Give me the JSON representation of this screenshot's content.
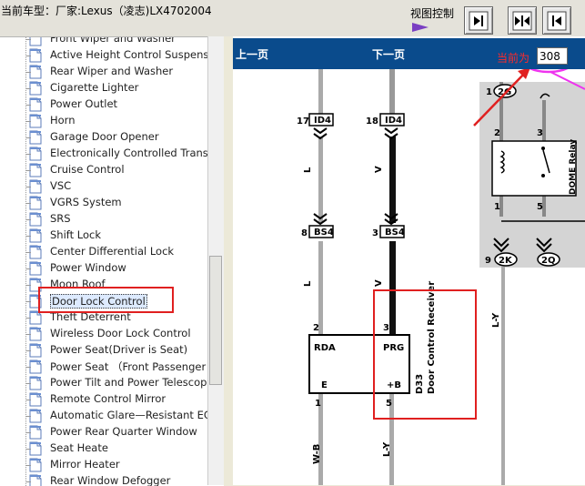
{
  "header": {
    "vehicle_label": "当前车型：厂家:Lexus（凌志)LX4702004",
    "view_control_label": "视图控制",
    "buttons": [
      {
        "name": "collapse-left-panel-button",
        "icon": "collapse-left-icon"
      },
      {
        "name": "show-both-panels-button",
        "icon": "expand-both-icon"
      },
      {
        "name": "collapse-right-panel-button",
        "icon": "collapse-right-icon"
      }
    ]
  },
  "tree": {
    "items": [
      {
        "label": "Front Wiper and Washer"
      },
      {
        "label": "Active Height Control Suspens"
      },
      {
        "label": "Rear Wiper and Washer"
      },
      {
        "label": "Cigarette Lighter"
      },
      {
        "label": "Power Outlet"
      },
      {
        "label": "Horn"
      },
      {
        "label": "Garage Door Opener"
      },
      {
        "label": "Electronically Controlled Trans"
      },
      {
        "label": "Cruise Control"
      },
      {
        "label": "VSC"
      },
      {
        "label": "VGRS System"
      },
      {
        "label": "SRS"
      },
      {
        "label": "Shift Lock"
      },
      {
        "label": "Center Differential Lock"
      },
      {
        "label": "Power Window"
      },
      {
        "label": "Moon Roof"
      },
      {
        "label": "Door Lock Control",
        "selected": true
      },
      {
        "label": "Theft Deterrent"
      },
      {
        "label": "Wireless Door Lock Control"
      },
      {
        "label": "Power Seat(Driver is Seat)"
      },
      {
        "label": "Power Seat （Front Passenger"
      },
      {
        "label": "Power Tilt and Power Telescop"
      },
      {
        "label": "Remote Control Mirror"
      },
      {
        "label": "Automatic Glare—Resistant EC"
      },
      {
        "label": "Power Rear Quarter Window"
      },
      {
        "label": "Seat Heate"
      },
      {
        "label": "Mirror Heater"
      },
      {
        "label": "Rear Window Defogger"
      }
    ]
  },
  "diagram_nav": {
    "prev_label": "上一页",
    "next_label": "下一页",
    "page_label": "当前为",
    "page_value": "308"
  },
  "diagram": {
    "texts": {
      "t17": "17",
      "id4a": "ID4",
      "t18": "18",
      "id4b": "ID4",
      "L1": "L",
      "V1": "V",
      "t8": "8",
      "bs4a": "BS4",
      "t3a": "3",
      "bs4b": "BS4",
      "L2": "L",
      "V2": "V",
      "t2": "2",
      "t3b": "3",
      "rda": "RDA",
      "prg": "PRG",
      "e": "E",
      "b": "+B",
      "t1": "1",
      "t5": "5",
      "wb": "W-B",
      "ly1": "L-Y",
      "d33": "D33",
      "receiver": "Door Control Receiver",
      "r1": "1",
      "r2g": "2G",
      "r2": "2",
      "r3": "3",
      "r1b": "1",
      "r5": "5",
      "relay": "DOME Relay",
      "r9": "9",
      "r2k": "2K",
      "r2q": "2Q",
      "ly2": "L-Y"
    }
  },
  "colors": {
    "nav_bar": "#0a4b8c",
    "annotation_red": "#e02020",
    "annotation_magenta": "#ee33ee",
    "page_label_red": "#ff2a2a"
  }
}
